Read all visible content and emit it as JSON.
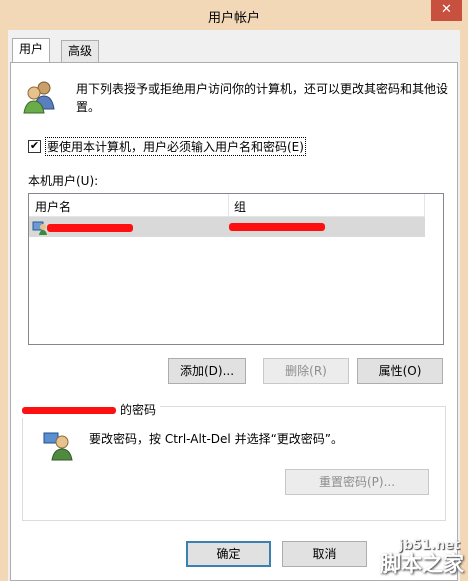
{
  "window": {
    "title": "用户帐户",
    "close_glyph": "✕"
  },
  "tabs": [
    {
      "label": "用户",
      "active": true
    },
    {
      "label": "高级",
      "active": false
    }
  ],
  "description": "用下列表授予或拒绝用户访问你的计算机，还可以更改其密码和其他设置。",
  "require_login": {
    "checked": true,
    "check_glyph": "✔",
    "label": "要使用本计算机，用户必须输入用户名和密码(E)"
  },
  "local_users": {
    "label": "本机用户(U):",
    "columns": [
      "用户名",
      "组"
    ],
    "rows": [
      {
        "username": "",
        "group": "",
        "redacted": true
      }
    ]
  },
  "user_buttons": {
    "add": "添加(D)...",
    "remove": "删除(R)",
    "properties": "属性(O)"
  },
  "password_group": {
    "caption": "的密码",
    "hint": "要改密码，按 Ctrl-Alt-Del 并选择“更改密码”。",
    "reset_button": "重置密码(P)..."
  },
  "dialog_buttons": {
    "ok": "确定",
    "cancel": "取消"
  },
  "watermark": {
    "url": "jb51.net",
    "name": "脚本之家"
  },
  "colors": {
    "title_bg": "#f3d8b8",
    "close_bg": "#c7503f",
    "redaction": "#ff1010",
    "default_border": "#3c7fb1"
  }
}
